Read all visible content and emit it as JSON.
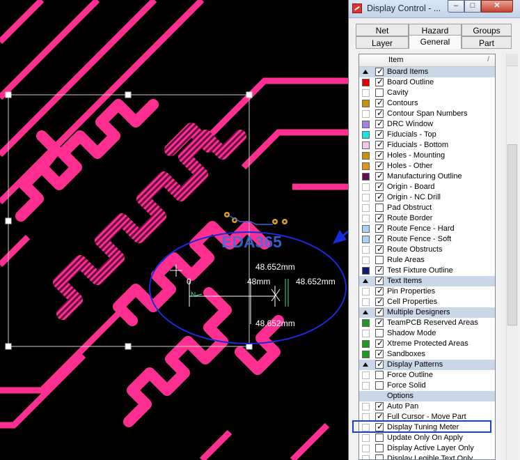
{
  "pcb": {
    "measurement_top": "48.652mm",
    "measurement_mid": "48mm",
    "measurement_right": "48.652mm",
    "measurement_bottom": "48.652mm",
    "zero_label": "0",
    "component_label": "N",
    "watermark": "EDA365",
    "colors": {
      "trace": "#ff2f92",
      "background": "#000000",
      "annotation": "#1a2bd8",
      "selection": "#cccccc",
      "dimension": "#39e39a"
    }
  },
  "dialog": {
    "title": "Display Control - ...",
    "min_glyph": "–",
    "max_glyph": "□",
    "close_glyph": "✕",
    "tabs_back": [
      "Net",
      "Hazard",
      "Groups"
    ],
    "tabs_front": [
      "Layer",
      "General",
      "Part"
    ],
    "active_tab": "General",
    "list_header": "Item",
    "list_header_sort": "/",
    "items": [
      {
        "label": "Board Items",
        "group": true,
        "checked": true,
        "color": ""
      },
      {
        "label": "Board Outline",
        "group": false,
        "checked": true,
        "color": "#e00000"
      },
      {
        "label": "Cavity",
        "group": false,
        "checked": false,
        "color": "#ffffff"
      },
      {
        "label": "Contours",
        "group": false,
        "checked": true,
        "color": "#c8900c"
      },
      {
        "label": "Contour Span Numbers",
        "group": false,
        "checked": true,
        "color": "#ffffff"
      },
      {
        "label": "DRC Window",
        "group": false,
        "checked": true,
        "color": "#a97de8"
      },
      {
        "label": "Fiducials - Top",
        "group": false,
        "checked": true,
        "color": "#1de0e0"
      },
      {
        "label": "Fiducials - Bottom",
        "group": false,
        "checked": true,
        "color": "#f0c8e8"
      },
      {
        "label": "Holes - Mounting",
        "group": false,
        "checked": true,
        "color": "#c8900c"
      },
      {
        "label": "Holes - Other",
        "group": false,
        "checked": true,
        "color": "#e0941a"
      },
      {
        "label": "Manufacturing Outline",
        "group": false,
        "checked": true,
        "color": "#650f55"
      },
      {
        "label": "Origin - Board",
        "group": false,
        "checked": true,
        "color": "#ffffff"
      },
      {
        "label": "Origin - NC Drill",
        "group": false,
        "checked": true,
        "color": "#ffffff"
      },
      {
        "label": "Pad Obstruct",
        "group": false,
        "checked": false,
        "color": "#ffffff"
      },
      {
        "label": "Route Border",
        "group": false,
        "checked": true,
        "color": "#ffffff"
      },
      {
        "label": "Route Fence - Hard",
        "group": false,
        "checked": true,
        "color": "#a9d0f5"
      },
      {
        "label": "Route Fence - Soft",
        "group": false,
        "checked": true,
        "color": "#a9d0f5"
      },
      {
        "label": "Route Obstructs",
        "group": false,
        "checked": true,
        "color": "#ffffff"
      },
      {
        "label": "Rule Areas",
        "group": false,
        "checked": false,
        "color": "#ffffff"
      },
      {
        "label": "Test Fixture Outline",
        "group": false,
        "checked": true,
        "color": "#101a70"
      },
      {
        "label": "Text Items",
        "group": true,
        "checked": true,
        "color": ""
      },
      {
        "label": "Pin Properties",
        "group": false,
        "checked": true,
        "color": "#ffffff"
      },
      {
        "label": "Cell Properties",
        "group": false,
        "checked": true,
        "color": "#ffffff"
      },
      {
        "label": "Multiple Designers",
        "group": true,
        "checked": true,
        "color": ""
      },
      {
        "label": "TeamPCB Reserved Areas",
        "group": false,
        "checked": true,
        "color": "#1f9a22"
      },
      {
        "label": "Shadow Mode",
        "group": false,
        "checked": false,
        "color": "#ffffff"
      },
      {
        "label": "Xtreme Protected Areas",
        "group": false,
        "checked": true,
        "color": "#1f9a22"
      },
      {
        "label": "Sandboxes",
        "group": false,
        "checked": true,
        "color": "#1f9a22"
      },
      {
        "label": "Display Patterns",
        "group": true,
        "checked": true,
        "color": ""
      },
      {
        "label": "Force Outline",
        "group": false,
        "checked": false,
        "color": "#ffffff"
      },
      {
        "label": "Force Solid",
        "group": false,
        "checked": false,
        "color": "#ffffff"
      },
      {
        "label": "Options",
        "group": true,
        "checked": false,
        "color": ""
      },
      {
        "label": "Auto Pan",
        "group": false,
        "checked": true,
        "color": "#ffffff"
      },
      {
        "label": "Full Cursor - Move Part",
        "group": false,
        "checked": true,
        "color": "#ffffff"
      },
      {
        "label": "Display Tuning Meter",
        "group": false,
        "checked": true,
        "color": "#ffffff"
      },
      {
        "label": "Update Only On Apply",
        "group": false,
        "checked": false,
        "color": "#ffffff"
      },
      {
        "label": "Display Active Layer Only",
        "group": false,
        "checked": false,
        "color": "#ffffff"
      },
      {
        "label": "Display Legible Text Only",
        "group": false,
        "checked": false,
        "color": "#ffffff"
      }
    ]
  }
}
